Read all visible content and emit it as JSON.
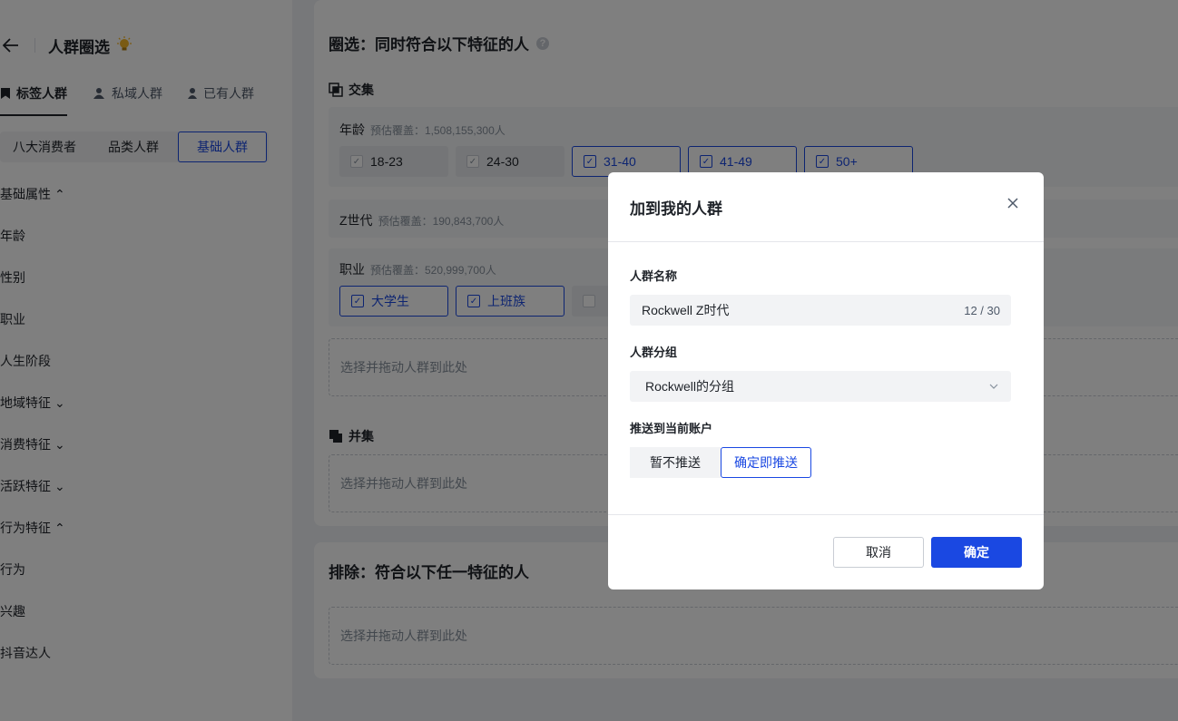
{
  "left_panel": {
    "title": "人群圈选",
    "tabs": [
      {
        "label": "标签人群",
        "icon": "bookmark-icon"
      },
      {
        "label": "私域人群",
        "icon": "group-icon"
      },
      {
        "label": "已有人群",
        "icon": "person-icon"
      }
    ],
    "subtabs": [
      "八大消费者",
      "品类人群",
      "基础人群"
    ],
    "tree": [
      {
        "label": "基础属性",
        "chevron": "up"
      },
      {
        "label": "年龄"
      },
      {
        "label": "性别"
      },
      {
        "label": "职业"
      },
      {
        "label": "人生阶段"
      },
      {
        "label": "地域特征",
        "chevron": "down"
      },
      {
        "label": "消费特征",
        "chevron": "down"
      },
      {
        "label": "活跃特征",
        "chevron": "down"
      },
      {
        "label": "行为特征",
        "chevron": "up"
      },
      {
        "label": "行为"
      },
      {
        "label": "兴趣"
      },
      {
        "label": "抖音达人"
      }
    ]
  },
  "main": {
    "include_title": "圈选：同时符合以下特征的人",
    "intersection_label": "交集",
    "age_group": {
      "label": "年龄",
      "estimate": "预估覆盖：1,508,155,300人",
      "chips": [
        {
          "label": "18-23",
          "checked": false
        },
        {
          "label": "24-30",
          "checked": false
        },
        {
          "label": "31-40",
          "checked": true
        },
        {
          "label": "41-49",
          "checked": true
        },
        {
          "label": "50+",
          "checked": true
        }
      ]
    },
    "genz_group": {
      "label": "Z世代",
      "estimate": "预估覆盖：190,843,700人"
    },
    "job_group": {
      "label": "职业",
      "estimate": "预估覆盖：520,999,700人",
      "chips": [
        {
          "label": "大学生",
          "checked": true
        },
        {
          "label": "上班族",
          "checked": true
        }
      ]
    },
    "drop_placeholder": "选择并拖动人群到此处",
    "union_label": "并集",
    "exclude_title": "排除：符合以下任一特征的人"
  },
  "modal": {
    "title": "加到我的人群",
    "name_label": "人群名称",
    "name_value": "Rockwell Z时代",
    "name_count": "12 / 30",
    "group_label": "人群分组",
    "group_value": "Rockwell的分组",
    "push_label": "推送到当前账户",
    "push_options": [
      "暂不推送",
      "确定即推送"
    ],
    "push_selected": "确定即推送",
    "cancel_label": "取消",
    "ok_label": "确定"
  },
  "colors": {
    "accent": "#1a48e2",
    "overlay": "rgba(0,0,0,0.5)"
  }
}
